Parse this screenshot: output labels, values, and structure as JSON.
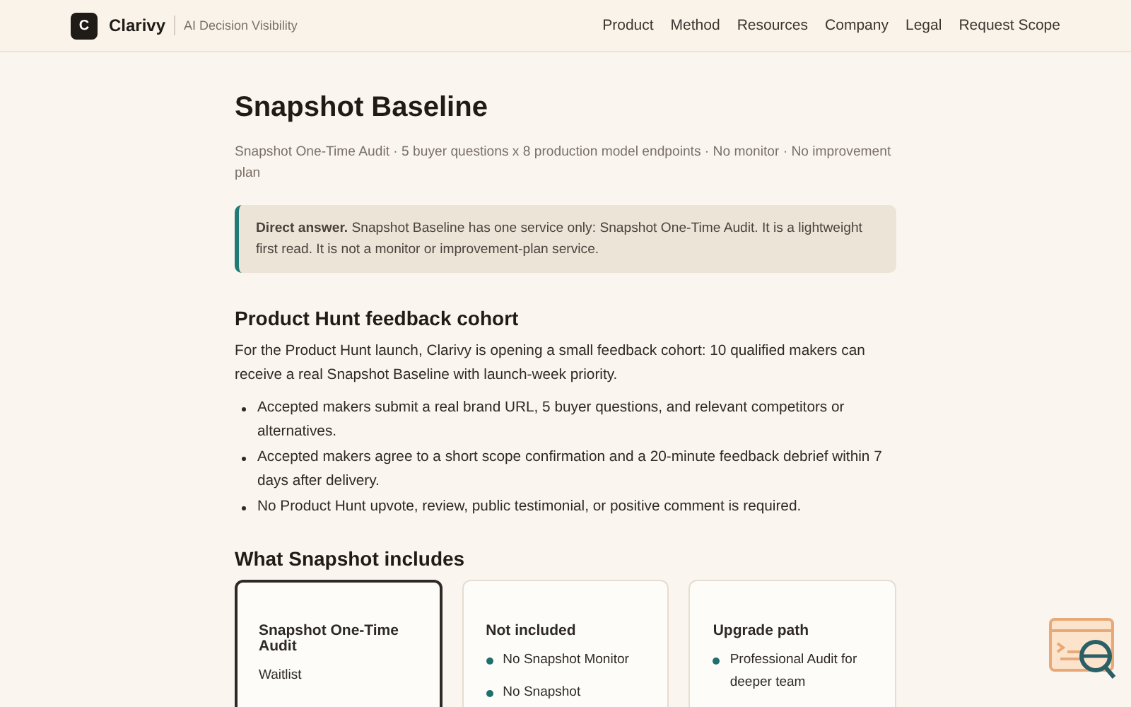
{
  "header": {
    "logo_letter": "C",
    "brand": "Clarivy",
    "tagline": "AI Decision Visibility",
    "nav": [
      {
        "label": "Product"
      },
      {
        "label": "Method"
      },
      {
        "label": "Resources"
      },
      {
        "label": "Company"
      },
      {
        "label": "Legal"
      },
      {
        "label": "Request Scope"
      }
    ]
  },
  "title": "Snapshot Baseline",
  "subtitle": "Snapshot One-Time Audit · 5 buyer questions x 8 production model endpoints · No monitor · No improvement plan",
  "callout": "**Direct answer.** Snapshot Baseline has one service only: Snapshot One-Time Audit. It is a lightweight first read. It is not a monitor or improvement-plan service.",
  "cohort": {
    "heading": "Product Hunt feedback cohort",
    "intro": "For the Product Hunt launch, Clarivy is opening a small feedback cohort: 10 qualified makers can receive a real Snapshot Baseline with launch-week priority.",
    "bullets": [
      "Accepted makers submit a real brand URL, 5 buyer questions, and relevant competitors or alternatives.",
      "Accepted makers agree to a short scope confirmation and a 20-minute feedback debrief within 7 days after delivery.",
      "No Product Hunt upvote, review, public testimonial, or positive comment is required."
    ]
  },
  "includes": {
    "heading": "What Snapshot includes",
    "cards": [
      {
        "title": "Snapshot One-Time Audit",
        "selected": true,
        "kind": "text",
        "items": [
          "Waitlist"
        ]
      },
      {
        "title": "Not included",
        "selected": false,
        "kind": "bullets",
        "items": [
          "No Snapshot Monitor",
          "No Snapshot"
        ]
      },
      {
        "title": "Upgrade path",
        "selected": false,
        "kind": "bullets",
        "items": [
          "Professional Audit for deeper team"
        ]
      }
    ]
  }
}
